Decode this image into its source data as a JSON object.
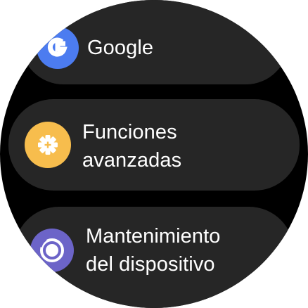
{
  "menu": {
    "items": [
      {
        "label_lines": [
          "Google"
        ],
        "icon": "google-icon",
        "color": "#4c7cf0"
      },
      {
        "label_lines": [
          "Funciones",
          "avanzadas"
        ],
        "icon": "gear-plus-icon",
        "color": "#f7bd4d"
      },
      {
        "label_lines": [
          "Mantenimiento",
          "del dispositivo"
        ],
        "icon": "device-care-icon",
        "color": "#6c64c8"
      }
    ]
  }
}
